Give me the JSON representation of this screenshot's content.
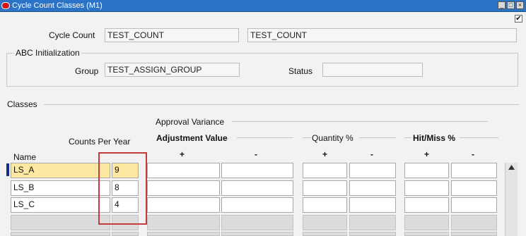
{
  "window": {
    "title": "Cycle Count Classes (M1)",
    "controls": [
      "_",
      "□",
      "×"
    ]
  },
  "header": {
    "cycle_count_label": "Cycle Count",
    "cycle_count_value": "TEST_COUNT",
    "cycle_count_desc": "TEST_COUNT",
    "abc_section_label": "ABC Initialization",
    "group_label": "Group",
    "group_value": "TEST_ASSIGN_GROUP",
    "status_label": "Status",
    "status_value": "",
    "checkbox_checked": "✔"
  },
  "classes": {
    "section_label": "Classes",
    "approval_variance_label": "Approval Variance",
    "adjustment_value_label": "Adjustment Value",
    "quantity_pct_label": "Quantity %",
    "hit_miss_pct_label": "Hit/Miss %",
    "counts_per_year_label": "Counts Per Year",
    "name_label": "Name",
    "plus": "+",
    "minus": "-",
    "rows": [
      {
        "name": "LS_A",
        "counts": "9"
      },
      {
        "name": "LS_B",
        "counts": "8"
      },
      {
        "name": "LS_C",
        "counts": "4"
      },
      {
        "name": "",
        "counts": ""
      },
      {
        "name": "",
        "counts": ""
      }
    ]
  },
  "colors": {
    "title_bar": "#2b73c7",
    "active_row": "#fce8a0",
    "highlight_box": "#c53a3a"
  }
}
